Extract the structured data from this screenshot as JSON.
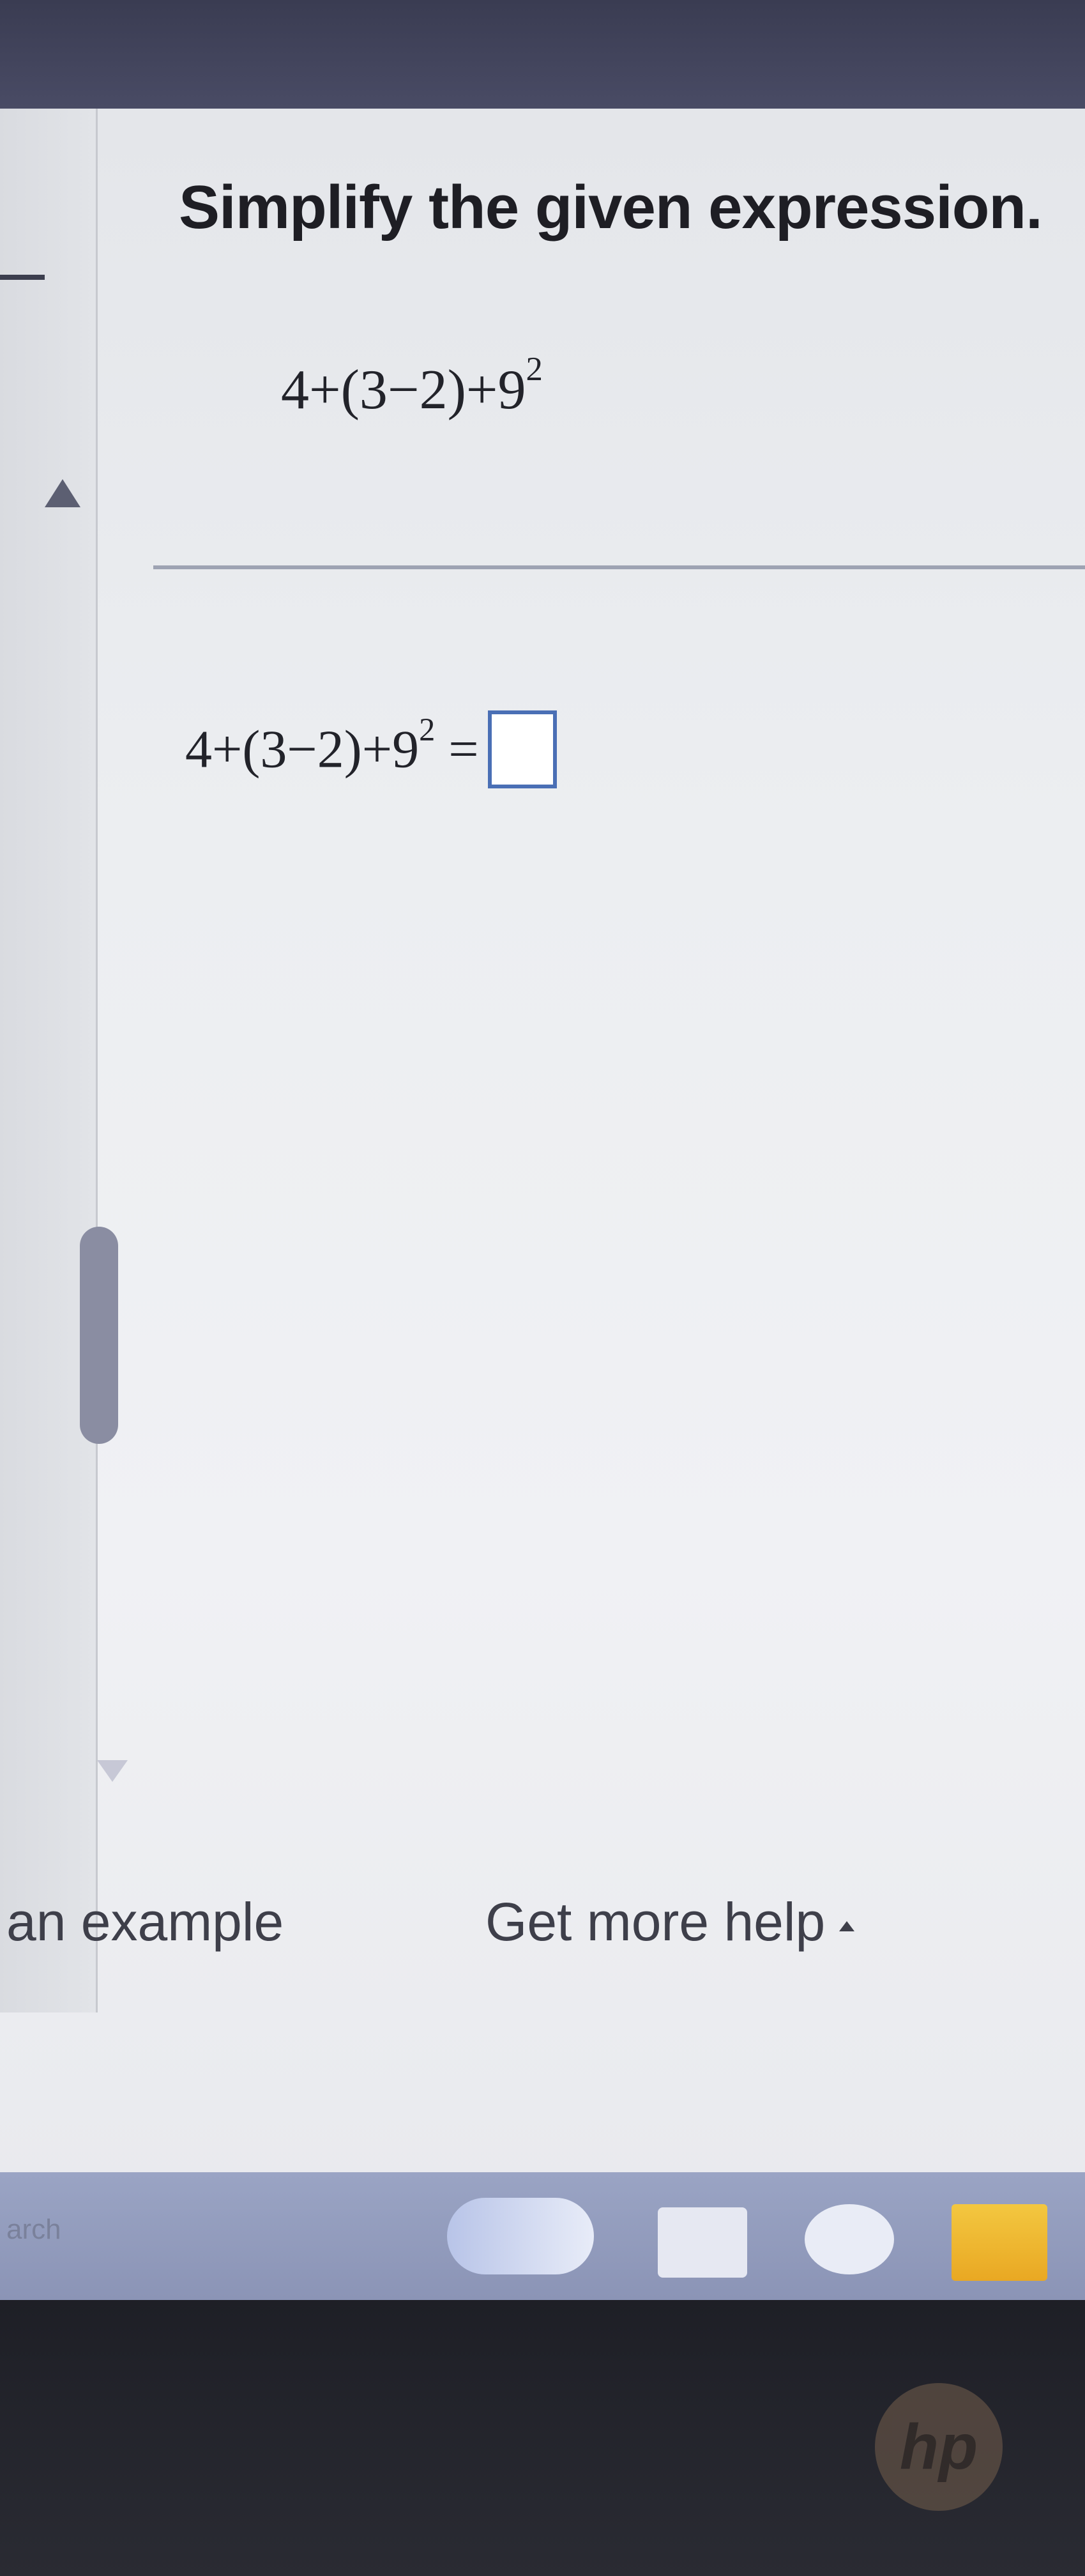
{
  "question": {
    "instruction": "Simplify the given expression.",
    "expression": {
      "base": "4+(3−2)+9",
      "exponent": "2"
    },
    "answer_line": {
      "lhs_base": "4+(3−2)+9",
      "lhs_exponent": "2",
      "equals": "=",
      "answer_value": ""
    }
  },
  "footer": {
    "view_example_label": "an example",
    "more_help_label": "Get more help"
  },
  "taskbar": {
    "search_label": "arch"
  },
  "device": {
    "logo_text": "hp"
  }
}
